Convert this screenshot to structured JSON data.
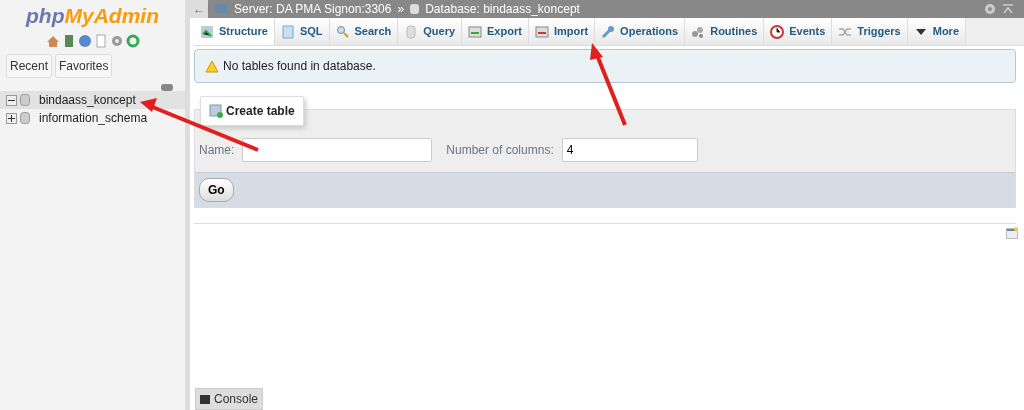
{
  "sidebar": {
    "logo": {
      "part_1": "php",
      "part_2": "MyAdmin"
    },
    "buttons": [
      "Recent",
      "Favorites"
    ],
    "tree": [
      {
        "label": "bindaass_koncept",
        "expanded": true,
        "selected": true
      },
      {
        "label": "information_schema",
        "expanded": false,
        "selected": false
      }
    ]
  },
  "breadcrumb": {
    "back": "←",
    "server": "Server: DA PMA Signon:3306",
    "separator": "»",
    "database": "Database: bindaass_koncept"
  },
  "tabs": [
    {
      "label": "Structure",
      "selected": true
    },
    {
      "label": "SQL",
      "selected": false
    },
    {
      "label": "Search",
      "selected": false
    },
    {
      "label": "Query",
      "selected": false
    },
    {
      "label": "Export",
      "selected": false
    },
    {
      "label": "Import",
      "selected": false
    },
    {
      "label": "Operations",
      "selected": false
    },
    {
      "label": "Routines",
      "selected": false
    },
    {
      "label": "Events",
      "selected": false
    },
    {
      "label": "Triggers",
      "selected": false
    },
    {
      "label": "More",
      "selected": false
    }
  ],
  "notice": "No tables found in database.",
  "create_table": {
    "legend": "Create table",
    "name_label": "Name:",
    "columns_label": "Number of columns:",
    "columns_value": "4",
    "button": "Go"
  },
  "console": "Console"
}
